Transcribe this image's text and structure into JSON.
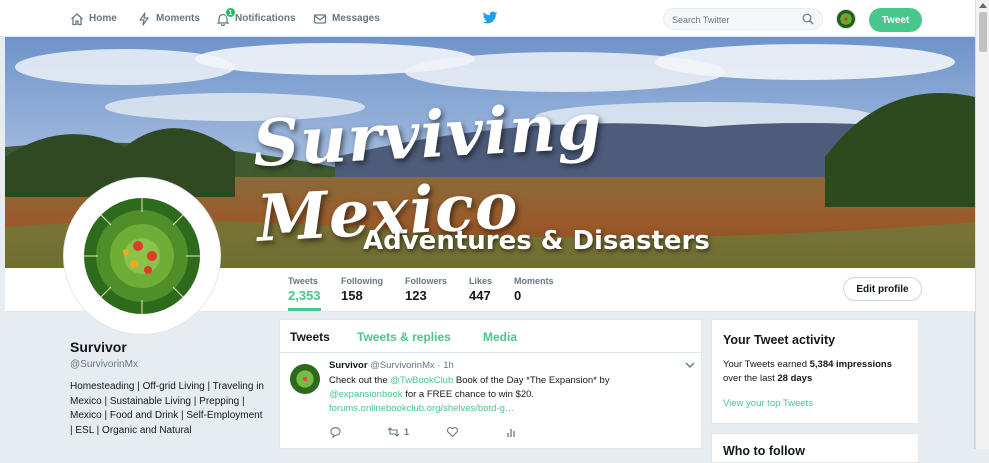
{
  "nav": {
    "home": "Home",
    "moments": "Moments",
    "notifications": "Notifications",
    "notif_count": "1",
    "messages": "Messages",
    "search_placeholder": "Search Twitter",
    "tweet_button": "Tweet"
  },
  "banner": {
    "title": "Surviving Mexico",
    "subtitle": "Adventures & Disasters"
  },
  "stats": [
    {
      "label": "Tweets",
      "value": "2,353"
    },
    {
      "label": "Following",
      "value": "158"
    },
    {
      "label": "Followers",
      "value": "123"
    },
    {
      "label": "Likes",
      "value": "447"
    },
    {
      "label": "Moments",
      "value": "0"
    }
  ],
  "edit_profile": "Edit profile",
  "profile": {
    "name": "Survivor",
    "handle": "@SurvivorinMx",
    "bio": "Homesteading | Off-grid Living | Traveling in Mexico | Sustainable Living | Prepping | Mexico | Food and Drink | Self-Employment | ESL | Organic and Natural"
  },
  "timeline": {
    "tabs": [
      "Tweets",
      "Tweets & replies",
      "Media"
    ],
    "tweet": {
      "name": "Survivor",
      "handle": "@SurvivorinMx",
      "sep": "·",
      "time": "1h",
      "text1": "Check out the ",
      "mention1": "@TwBookClub",
      "text2": " Book of the Day *The Expansion* by ",
      "mention2": "@expansionbook",
      "text3": " for a FREE chance to win $20.",
      "link": "forums.onlinebookclub.org/shelves/botd-g…",
      "retweets": "1"
    }
  },
  "activity": {
    "title": "Your Tweet activity",
    "text_a": "Your Tweets earned ",
    "impressions": "5,384 impressions",
    "text_b": " over the last ",
    "period": "28 days",
    "link": "View your top Tweets"
  },
  "who_to_follow": "Who to follow",
  "colors": {
    "accent": "#47c78c",
    "muted": "#657786",
    "border": "#e1e8ed",
    "bg": "#e6ecf0"
  },
  "icons": [
    "home-icon",
    "lightning-icon",
    "bell-icon",
    "envelope-icon",
    "twitter-bird-icon",
    "search-icon",
    "reply-icon",
    "retweet-icon",
    "heart-icon",
    "analytics-icon",
    "chevron-down-icon"
  ]
}
